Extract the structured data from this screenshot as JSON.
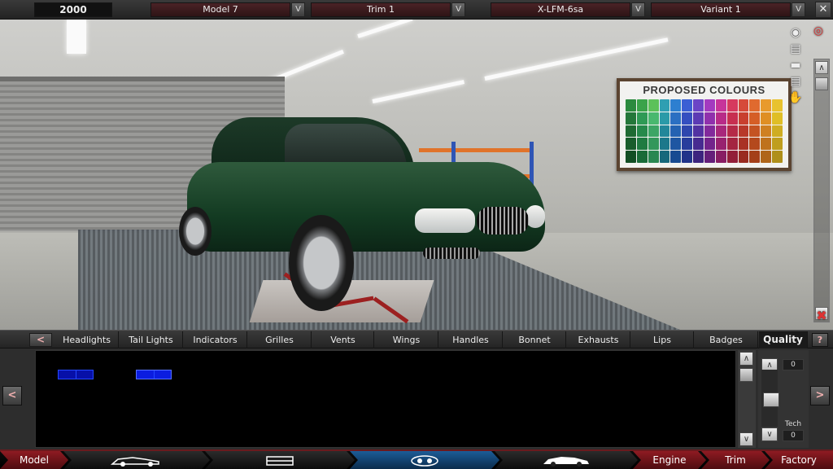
{
  "topbar": {
    "year": "2000",
    "model": "Model 7",
    "trim": "Trim 1",
    "engine": "X-LFM-6sa",
    "variant": "Variant 1",
    "dropdown_glyph": "V",
    "close_glyph": "✕"
  },
  "viewport": {
    "board_title": "PROPOSED COLOURS",
    "swatch_colors": [
      "#2b8a3e",
      "#3aa34a",
      "#5cc15a",
      "#2f9fb2",
      "#2d7fd0",
      "#3b5fd4",
      "#6b45c6",
      "#a33ac0",
      "#c7349a",
      "#d63a5e",
      "#d64a3a",
      "#e06a2f",
      "#e89a2c",
      "#e8c22e",
      "#24773a",
      "#2f9a55",
      "#49b86f",
      "#2a9aa8",
      "#2b6fc2",
      "#354fc0",
      "#5c3ab4",
      "#9030ad",
      "#b82b88",
      "#c72f50",
      "#c8402f",
      "#d55e26",
      "#df8f24",
      "#dfbe26",
      "#1f6a33",
      "#26894b",
      "#3ca565",
      "#22879a",
      "#2462b2",
      "#2f46ae",
      "#5232a2",
      "#82299c",
      "#a8277b",
      "#b52a48",
      "#b8382a",
      "#c45322",
      "#cf8021",
      "#cfad22",
      "#185c2b",
      "#1f7a41",
      "#33975b",
      "#1c788b",
      "#1e56a2",
      "#283d9c",
      "#472b90",
      "#73248b",
      "#98226f",
      "#a42541",
      "#a93225",
      "#b4491d",
      "#bf721d",
      "#bf9e1e",
      "#124e24",
      "#196b38",
      "#2a8751",
      "#17687b",
      "#184a91",
      "#21348a",
      "#3c247e",
      "#651f7a",
      "#881d63",
      "#921f39",
      "#992b20",
      "#a43f19",
      "#af6519",
      "#af8f1a"
    ],
    "side_icons": [
      "camera-icon",
      "eye-icon",
      "chassis-icon",
      "car-side-icon",
      "lift-icon",
      "hand-icon",
      "delete-icon"
    ],
    "scroll_up": "∧",
    "scroll_down": "∨"
  },
  "tabs": {
    "prev": "<",
    "items": [
      "Headlights",
      "Tail Lights",
      "Indicators",
      "Grilles",
      "Vents",
      "Wings",
      "Handles",
      "Bonnet",
      "Exhausts",
      "Lips",
      "Badges"
    ],
    "quality": "Quality",
    "help": "?"
  },
  "panel": {
    "left_arrow": "<",
    "right_arrow": ">",
    "scroll_up": "∧",
    "scroll_down": "∨",
    "quality_value": "0",
    "tech_label": "Tech",
    "tech_value": "0"
  },
  "bottomnav": {
    "model": "Model",
    "engine": "Engine",
    "trim": "Trim",
    "factory": "Factory",
    "icons": [
      "car-design-icon",
      "chassis-icon",
      "headlight-icon",
      "car-side-icon"
    ]
  },
  "colors": {
    "accent_red": "#8e1b22",
    "accent_blue": "#1c5c97",
    "part_blue": "#2448ff"
  }
}
